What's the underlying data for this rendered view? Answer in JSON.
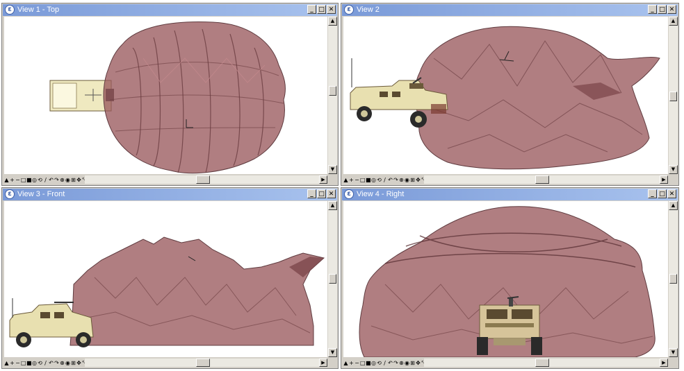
{
  "views": [
    {
      "title": "View 1 - Top"
    },
    {
      "title": "View 2"
    },
    {
      "title": "View 3 - Front"
    },
    {
      "title": "View 4 - Right"
    }
  ],
  "window_controls": {
    "minimize": "_",
    "maximize": "□",
    "close": "✕"
  },
  "app_icon_glyph": "ε",
  "toolbar": [
    "▲",
    "+",
    "−",
    "□",
    "■",
    "◎",
    "⟲",
    "∕",
    "↶",
    "↷",
    "⊕",
    "◉",
    "⊞",
    "✥",
    "⤡",
    "◂"
  ],
  "icon_names": [
    "tool-up-icon",
    "zoom-in-icon",
    "zoom-out-icon",
    "frame-icon",
    "fill-icon",
    "orbit-icon",
    "rotate-icon",
    "pencil-icon",
    "undo-icon",
    "redo-icon",
    "target-icon",
    "camera-icon",
    "grid-icon",
    "pan-icon",
    "fit-icon",
    "scroll-left-icon"
  ],
  "colors": {
    "titlebar": "#7a9ad8",
    "mesh_fill": "#9a5a5e",
    "mesh_edge": "#5f3b3f",
    "vehicle_body": "#e8e0b0",
    "vehicle_dark": "#6b5a3a"
  }
}
